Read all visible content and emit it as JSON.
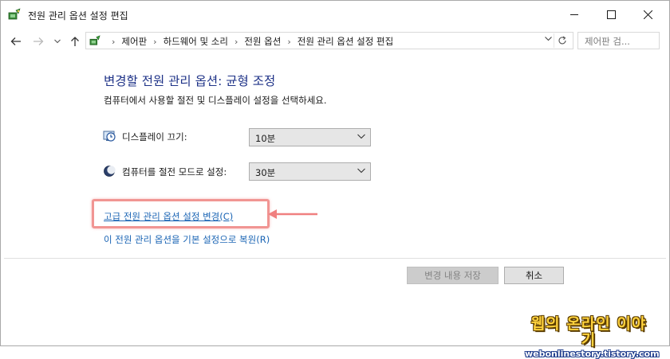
{
  "window": {
    "title": "전원 관리 옵션 설정 편집",
    "icon": "power-options-icon"
  },
  "nav": {
    "breadcrumbs": [
      "제어판",
      "하드웨어 및 소리",
      "전원 옵션",
      "전원 관리 옵션 설정 편집"
    ],
    "search_placeholder": "제어판 검..."
  },
  "main": {
    "heading": "변경할 전원 관리 옵션: 균형 조정",
    "description": "컴퓨터에서 사용할 절전 및 디스플레이 설정을 선택하세요.",
    "settings": [
      {
        "label": "디스플레이 끄기:",
        "value": "10분",
        "icon": "display-clock-icon"
      },
      {
        "label": "컴퓨터를 절전 모드로 설정:",
        "value": "30분",
        "icon": "sleep-moon-icon"
      }
    ],
    "links": {
      "advanced": "고급 전원 관리 옵션 설정 변경(C)",
      "restore": "이 전원 관리 옵션을 기본 설정으로 복원(R)"
    },
    "highlight_color": "#f19593",
    "link_color": "#1a64b4"
  },
  "buttons": {
    "save": "변경 내용 저장",
    "cancel": "취소"
  },
  "watermark": {
    "line1": "웹의 온라인 이야기",
    "line2": "webonlinestory.tistory.com"
  }
}
